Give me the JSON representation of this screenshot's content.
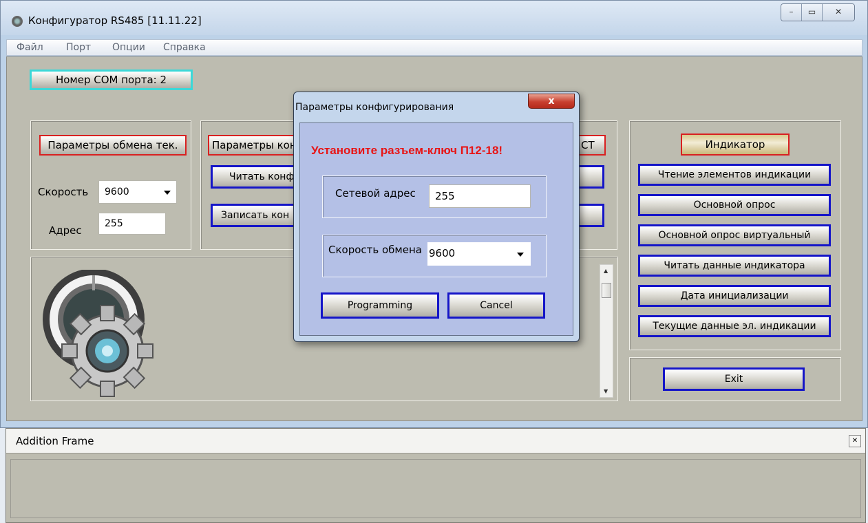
{
  "window": {
    "title": "Конфигуратор RS485 [11.11.22]",
    "controls": {
      "minimize": "–",
      "maximize": "▭",
      "close": "✕"
    }
  },
  "menu": [
    "Файл",
    "Порт",
    "Опции",
    "Справка"
  ],
  "com_port": "Номер COM порта:  2",
  "left_panel": {
    "header": "Параметры обмена тек.",
    "speed_label": "Скорость",
    "speed_value": "9600",
    "address_label": "Адрес",
    "address_value": "255"
  },
  "middle_panel": {
    "header": "Параметры кон",
    "header_right": "СТ",
    "read_button": "Читать конф",
    "write_button": "Записать кон"
  },
  "indicator_panel": {
    "header": "Индикатор",
    "buttons": [
      "Чтение элементов индикации",
      "Основной опрос",
      "Основной опрос виртуальный",
      "Читать данные индикатора",
      "Дата инициализации",
      "Текущие данные эл. индикации"
    ]
  },
  "exit_button": "Exit",
  "bottom_frame": {
    "title": "Addition Frame",
    "close": "✕"
  },
  "dialog": {
    "title": "Параметры конфигурирования",
    "close": "x",
    "warning": "Установите разъем-ключ  П12-18!",
    "network_address_label": "Сетевой адрес",
    "network_address_value": "255",
    "exchange_speed_label": "Скорость обмена",
    "exchange_speed_value": "9600",
    "programming_button": "Programming",
    "cancel_button": "Cancel"
  },
  "colors": {
    "button_border_blue": "#1515c8",
    "header_border_red": "#d92020",
    "warning_red": "#e81414",
    "com_border_cyan": "#3cd8d8",
    "client_bg": "#bdbcb0"
  }
}
